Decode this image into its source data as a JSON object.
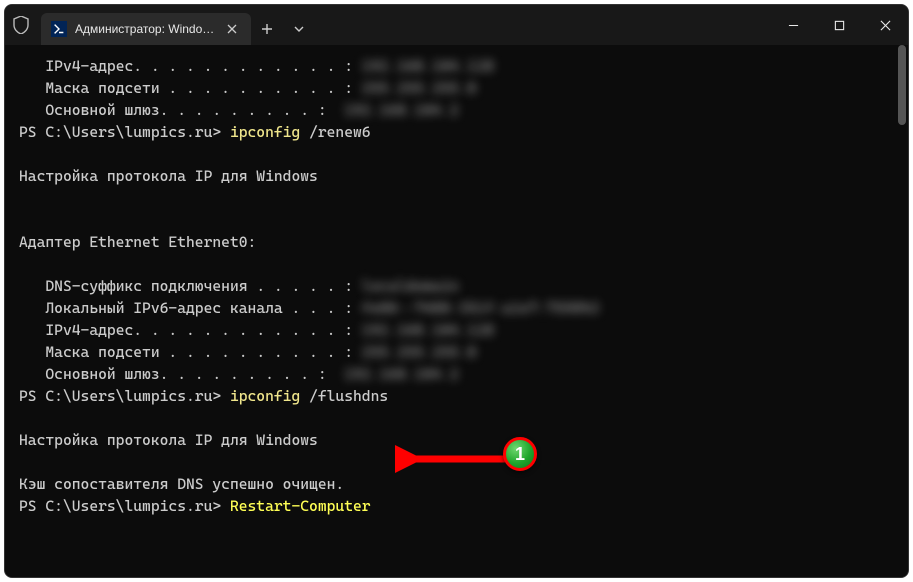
{
  "tab": {
    "title": "Администратор: Windows Pc"
  },
  "lines": [
    {
      "indent": "   ",
      "label": "IPv4-адрес. . . . . . . . . . . . : ",
      "blurvalue": "192.168.104.128"
    },
    {
      "indent": "   ",
      "label": "Маска подсети . . . . . . . . . . : ",
      "blurvalue": "255.255.255.0"
    },
    {
      "indent": "   ",
      "label": "Основной шлюз. . . . . . . . . :  ",
      "blurvalue": "192.168.104.2"
    },
    {
      "prompt": "PS C:\\Users\\lumpics.ru> ",
      "cmd": "ipconfig",
      "arg": " /renew6"
    },
    {
      "text": ""
    },
    {
      "text": "Настройка протокола IP для Windows"
    },
    {
      "text": ""
    },
    {
      "text": ""
    },
    {
      "text": "Адаптер Ethernet Ethernet0:"
    },
    {
      "text": ""
    },
    {
      "indent": "   ",
      "label": "DNS-суффикс подключения . . . . . : ",
      "blurvalue": "localdomain"
    },
    {
      "indent": "   ",
      "label": "Локальный IPv6-адрес канала . . . : ",
      "blurvalue": "fe80::7488:351f:a1e7:7598%3"
    },
    {
      "indent": "   ",
      "label": "IPv4-адрес. . . . . . . . . . . . : ",
      "blurvalue": "192.168.104.128"
    },
    {
      "indent": "   ",
      "label": "Маска подсети . . . . . . . . . . : ",
      "blurvalue": "255.255.255.0"
    },
    {
      "indent": "   ",
      "label": "Основной шлюз. . . . . . . . . :  ",
      "blurvalue": "192.168.104.2"
    },
    {
      "prompt": "PS C:\\Users\\lumpics.ru> ",
      "cmd": "ipconfig",
      "arg": " /flushdns"
    },
    {
      "text": ""
    },
    {
      "text": "Настройка протокола IP для Windows"
    },
    {
      "text": ""
    },
    {
      "text": "Кэш сопоставителя DNS успешно очищен."
    },
    {
      "prompt": "PS C:\\Users\\lumpics.ru> ",
      "hl": "Restart-Computer"
    }
  ],
  "annotation": {
    "badge": "1"
  }
}
